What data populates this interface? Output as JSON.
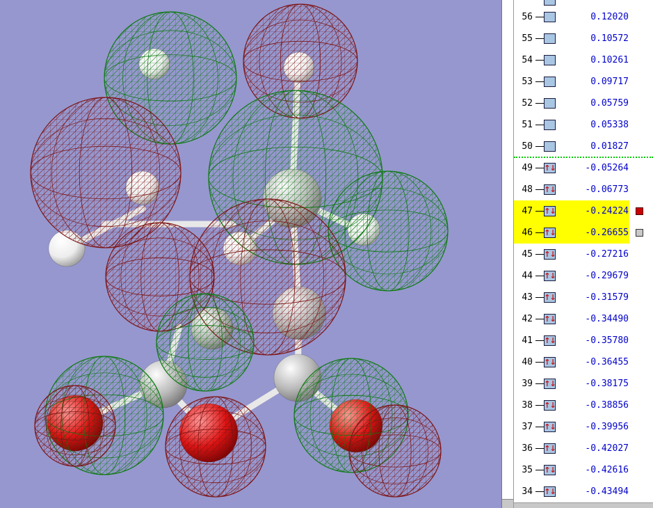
{
  "colors": {
    "panel_bg": "#FFFFFF",
    "highlight": "#FFFF00",
    "energy_text": "#0000CC",
    "orbital_number_text": "#000000",
    "square_fill": "#A9C6E3",
    "square_border": "#1A1A3A",
    "arrow": "#CC1111",
    "separator": "#00CC00",
    "marker_red": "#CC0000",
    "marker_gray": "#C9C9C9",
    "scrollbar_border": "#999999",
    "corner_gray": "#C8C8C8"
  },
  "viewport": {
    "background": "#9697CE",
    "bond_color": "#E8E8E8",
    "lobe_colors": {
      "green": "#0E7A12",
      "darkred": "#7E1414"
    },
    "atom_colors": {
      "H": "#EDEDED",
      "C": "#B9B9B9",
      "O": "#DE1414"
    },
    "atom_shade": {
      "H": "#8F8F8F",
      "C": "#6E6E6E",
      "O": "#6A0000"
    },
    "lobes": [
      [
        245,
        112,
        95,
        "green"
      ],
      [
        432,
        88,
        82,
        "darkred"
      ],
      [
        152,
        248,
        108,
        "darkred"
      ],
      [
        425,
        255,
        125,
        "green"
      ],
      [
        558,
        332,
        86,
        "green"
      ],
      [
        230,
        398,
        78,
        "darkred"
      ],
      [
        385,
        398,
        112,
        "darkred"
      ],
      [
        295,
        492,
        70,
        "green"
      ],
      [
        150,
        597,
        85,
        "green"
      ],
      [
        108,
        612,
        58,
        "darkred"
      ],
      [
        310,
        642,
        72,
        "darkred"
      ],
      [
        505,
        597,
        82,
        "green"
      ],
      [
        568,
        648,
        66,
        "darkred"
      ]
    ],
    "atoms": [
      [
        420,
        285,
        42,
        "C"
      ],
      [
        430,
        450,
        38,
        "C"
      ],
      [
        305,
        472,
        30,
        "C"
      ],
      [
        222,
        92,
        22,
        "H"
      ],
      [
        430,
        97,
        22,
        "H"
      ],
      [
        205,
        270,
        24,
        "H"
      ],
      [
        96,
        357,
        26,
        "H"
      ],
      [
        345,
        357,
        24,
        "H"
      ],
      [
        523,
        330,
        23,
        "H"
      ],
      [
        235,
        552,
        34,
        "C"
      ],
      [
        428,
        543,
        34,
        "C"
      ],
      [
        108,
        608,
        40,
        "O"
      ],
      [
        300,
        622,
        42,
        "O"
      ],
      [
        512,
        612,
        38,
        "O"
      ]
    ],
    "bonds": [
      [
        96,
        357,
        205,
        300
      ],
      [
        150,
        322,
        335,
        322
      ],
      [
        345,
        357,
        418,
        295
      ],
      [
        420,
        285,
        428,
        110
      ],
      [
        420,
        285,
        520,
        332
      ],
      [
        420,
        285,
        430,
        450
      ],
      [
        430,
        450,
        428,
        543
      ],
      [
        428,
        543,
        512,
        612
      ],
      [
        428,
        543,
        300,
        622
      ],
      [
        235,
        552,
        300,
        622
      ],
      [
        235,
        552,
        108,
        608
      ],
      [
        235,
        552,
        258,
        470
      ]
    ]
  },
  "orbital_list": {
    "icons": {
      "spin_up": "↑",
      "spin_down": "↓"
    },
    "rows": [
      {
        "num": "",
        "partial": true,
        "occupied": false
      },
      {
        "num": "56",
        "energy": "0.12020",
        "occupied": false
      },
      {
        "num": "55",
        "energy": "0.10572",
        "occupied": false
      },
      {
        "num": "54",
        "energy": "0.10261",
        "occupied": false
      },
      {
        "num": "53",
        "energy": "0.09717",
        "occupied": false
      },
      {
        "num": "52",
        "energy": "0.05759",
        "occupied": false
      },
      {
        "num": "51",
        "energy": "0.05338",
        "occupied": false
      },
      {
        "num": "50",
        "energy": "0.01827",
        "occupied": false,
        "separator_after": true
      },
      {
        "num": "49",
        "energy": "-0.05264",
        "occupied": true
      },
      {
        "num": "48",
        "energy": "-0.06773",
        "occupied": true
      },
      {
        "num": "47",
        "energy": "-0.24224",
        "occupied": true,
        "highlight": true,
        "marker": "red"
      },
      {
        "num": "46",
        "energy": "-0.26655",
        "occupied": true,
        "highlight": true,
        "marker": "gray"
      },
      {
        "num": "45",
        "energy": "-0.27216",
        "occupied": true
      },
      {
        "num": "44",
        "energy": "-0.29679",
        "occupied": true
      },
      {
        "num": "43",
        "energy": "-0.31579",
        "occupied": true
      },
      {
        "num": "42",
        "energy": "-0.34490",
        "occupied": true
      },
      {
        "num": "41",
        "energy": "-0.35780",
        "occupied": true
      },
      {
        "num": "40",
        "energy": "-0.36455",
        "occupied": true
      },
      {
        "num": "39",
        "energy": "-0.38175",
        "occupied": true
      },
      {
        "num": "38",
        "energy": "-0.38856",
        "occupied": true
      },
      {
        "num": "37",
        "energy": "-0.39956",
        "occupied": true
      },
      {
        "num": "36",
        "energy": "-0.42027",
        "occupied": true
      },
      {
        "num": "35",
        "energy": "-0.42616",
        "occupied": true
      },
      {
        "num": "34",
        "energy": "-0.43494",
        "occupied": true
      }
    ]
  }
}
